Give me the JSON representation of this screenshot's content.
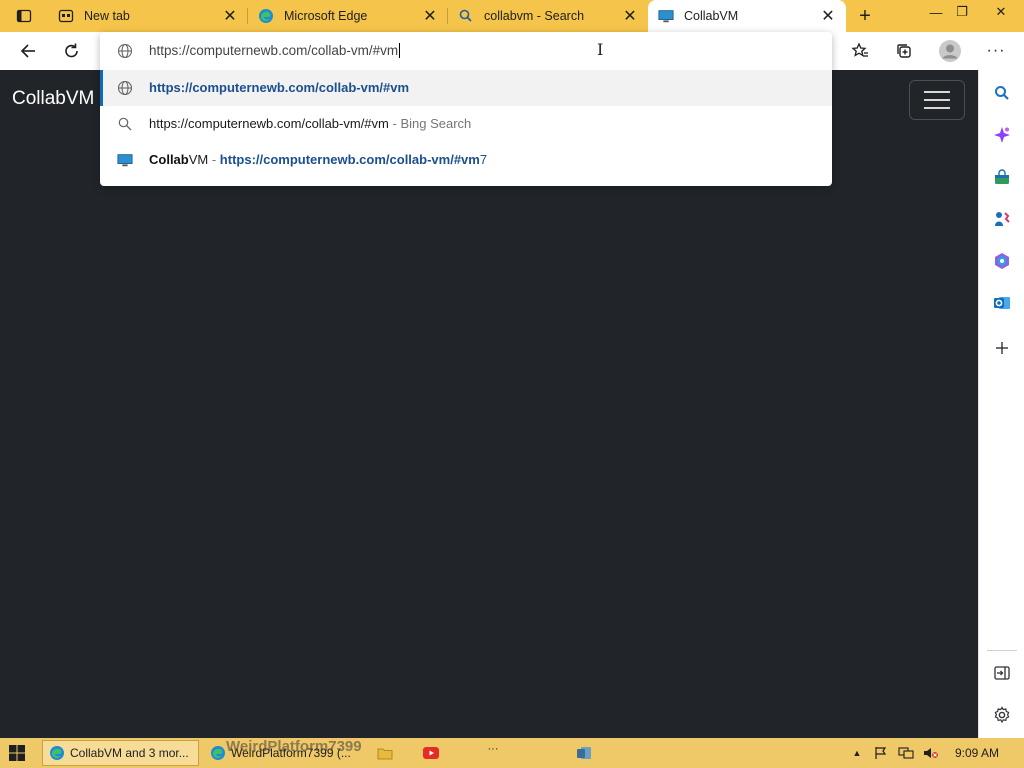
{
  "browser": {
    "tabs": [
      {
        "title": "New tab",
        "icon": "new-tab-icon",
        "close": "✕"
      },
      {
        "title": "Microsoft Edge",
        "icon": "edge-icon",
        "close": "✕"
      },
      {
        "title": "collabvm - Search",
        "icon": "search-icon",
        "close": "✕"
      },
      {
        "title": "CollabVM",
        "icon": "monitor-icon",
        "close": "✕",
        "active": true
      }
    ],
    "new_tab_label": "+",
    "window_controls": {
      "minimize": "—",
      "restore": "❐",
      "close": "✕"
    }
  },
  "omnibox": {
    "typed_text": "https://computernewb.com/collab-vm/#vm",
    "suggestions": [
      {
        "icon": "globe-icon",
        "url": "https://computernewb.com/collab-vm/#vm",
        "selected": true
      },
      {
        "icon": "search-icon",
        "query": "https://computernewb.com/collab-vm/#vm",
        "sep": " - ",
        "engine": "Bing Search"
      },
      {
        "icon": "monitor-icon",
        "title_bold": "Collab",
        "title_rest": "VM",
        "sep": " - ",
        "url_bold": "https://computernewb.com/collab-vm/#vm",
        "url_rest": "7"
      }
    ]
  },
  "page": {
    "brand": "CollabVM",
    "bg_color": "#212529"
  },
  "sidebar": {
    "items": [
      "search-icon",
      "copilot-icon",
      "shopping-icon",
      "games-icon",
      "office-icon",
      "outlook-icon",
      "add-icon"
    ],
    "bottom": [
      "split-screen-icon",
      "settings-icon"
    ]
  },
  "taskbar": {
    "items": [
      {
        "label": "CollabVM and 3 mor...",
        "icon": "edge-icon"
      },
      {
        "label": "WeirdPlatform7399 (...",
        "icon": "edge-icon"
      }
    ],
    "watermark": "WeirdPlatform7399",
    "overflow": "···",
    "time": "9:09 AM"
  },
  "colors": {
    "accent": "#f5c44a",
    "taskbar": "#efc867",
    "link": "#1b4f8e"
  }
}
